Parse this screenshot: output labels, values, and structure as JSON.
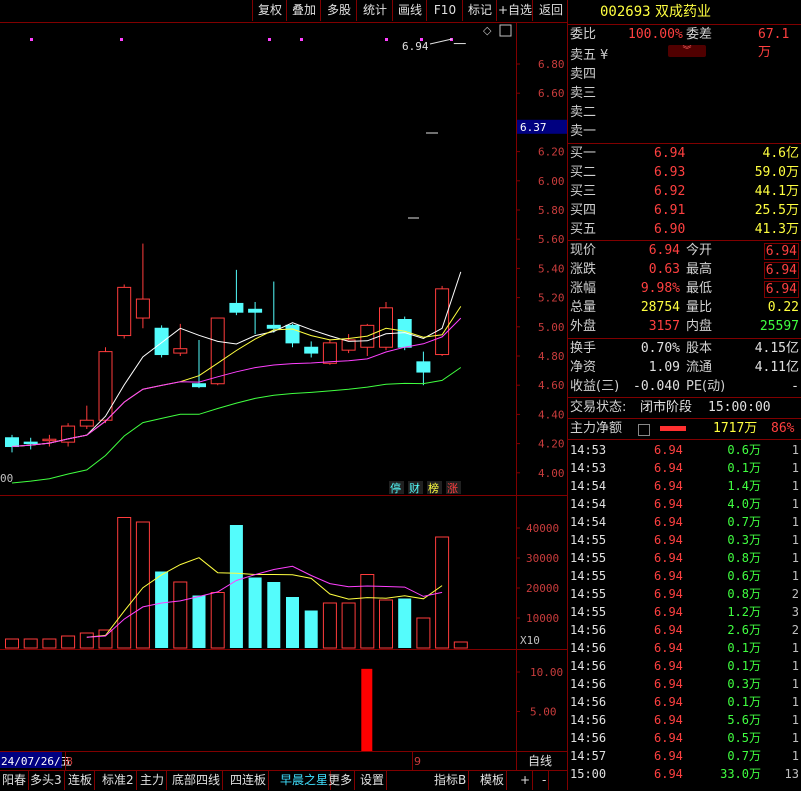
{
  "toolbar": {
    "buttons": [
      "复权",
      "叠加",
      "多股",
      "统计",
      "画线",
      "F10",
      "标记",
      "+自选",
      "返回"
    ]
  },
  "stock": {
    "code": "002693",
    "name": "双成药业"
  },
  "order_ratio": {
    "label": "委比",
    "value": "100.00%",
    "diff_label": "委差",
    "diff_value": "67.1万"
  },
  "asks": [
    {
      "label": "卖五",
      "price": "",
      "vol": ""
    },
    {
      "label": "卖四",
      "price": "",
      "vol": ""
    },
    {
      "label": "卖三",
      "price": "",
      "vol": ""
    },
    {
      "label": "卖二",
      "price": "",
      "vol": ""
    },
    {
      "label": "卖一",
      "price": "",
      "vol": ""
    }
  ],
  "bids": [
    {
      "label": "买一",
      "price": "6.94",
      "vol": "4.6亿"
    },
    {
      "label": "买二",
      "price": "6.93",
      "vol": "59.0万"
    },
    {
      "label": "买三",
      "price": "6.92",
      "vol": "44.1万"
    },
    {
      "label": "买四",
      "price": "6.91",
      "vol": "25.5万"
    },
    {
      "label": "买五",
      "price": "6.90",
      "vol": "41.3万"
    }
  ],
  "quote": [
    {
      "l1": "现价",
      "v1": "6.94",
      "l2": "今开",
      "v2": "6.94"
    },
    {
      "l1": "涨跌",
      "v1": "0.63",
      "l2": "最高",
      "v2": "6.94"
    },
    {
      "l1": "涨幅",
      "v1": "9.98%",
      "l2": "最低",
      "v2": "6.94"
    },
    {
      "l1": "总量",
      "v1": "28754",
      "l2": "量比",
      "v2": "0.22"
    },
    {
      "l1": "外盘",
      "v1": "3157",
      "l2": "内盘",
      "v2": "25597"
    }
  ],
  "stats": [
    {
      "l1": "换手",
      "v1": "0.70%",
      "l2": "股本",
      "v2": "4.15亿"
    },
    {
      "l1": "净资",
      "v1": "1.09",
      "l2": "流通",
      "v2": "4.11亿"
    },
    {
      "l1": "收益(三)",
      "v1": "-0.040",
      "l2": "PE(动)",
      "v2": "-"
    }
  ],
  "trade_status": {
    "label": "交易状态:",
    "phase": "闭市阶段",
    "time": "15:00:00"
  },
  "main_net": {
    "label": "主力净额",
    "value": "1717万",
    "pct": "86%"
  },
  "ticks": [
    {
      "t": "14:53",
      "p": "6.94",
      "v": "0.6万",
      "n": "1"
    },
    {
      "t": "14:53",
      "p": "6.94",
      "v": "0.1万",
      "n": "1"
    },
    {
      "t": "14:54",
      "p": "6.94",
      "v": "1.4万",
      "n": "1"
    },
    {
      "t": "14:54",
      "p": "6.94",
      "v": "4.0万",
      "n": "1"
    },
    {
      "t": "14:54",
      "p": "6.94",
      "v": "0.7万",
      "n": "1"
    },
    {
      "t": "14:55",
      "p": "6.94",
      "v": "0.3万",
      "n": "1"
    },
    {
      "t": "14:55",
      "p": "6.94",
      "v": "0.8万",
      "n": "1"
    },
    {
      "t": "14:55",
      "p": "6.94",
      "v": "0.6万",
      "n": "1"
    },
    {
      "t": "14:55",
      "p": "6.94",
      "v": "0.8万",
      "n": "2"
    },
    {
      "t": "14:55",
      "p": "6.94",
      "v": "1.2万",
      "n": "3"
    },
    {
      "t": "14:56",
      "p": "6.94",
      "v": "2.6万",
      "n": "2"
    },
    {
      "t": "14:56",
      "p": "6.94",
      "v": "0.1万",
      "n": "1"
    },
    {
      "t": "14:56",
      "p": "6.94",
      "v": "0.1万",
      "n": "1"
    },
    {
      "t": "14:56",
      "p": "6.94",
      "v": "0.3万",
      "n": "1"
    },
    {
      "t": "14:56",
      "p": "6.94",
      "v": "0.1万",
      "n": "1"
    },
    {
      "t": "14:56",
      "p": "6.94",
      "v": "5.6万",
      "n": "1"
    },
    {
      "t": "14:56",
      "p": "6.94",
      "v": "0.5万",
      "n": "1"
    },
    {
      "t": "14:57",
      "p": "6.94",
      "v": "0.7万",
      "n": "1"
    },
    {
      "t": "15:00",
      "p": "6.94",
      "v": "33.0万",
      "n": "13"
    }
  ],
  "chart_data": {
    "type": "candlestick",
    "price_axis": [
      "6.80",
      "6.60",
      "6.37",
      "6.20",
      "6.00",
      "5.80",
      "5.60",
      "5.40",
      "5.20",
      "5.00",
      "4.80",
      "4.60",
      "4.40",
      "4.20",
      "4.00"
    ],
    "current_price_label": "6.37",
    "high_marker": "6.94",
    "left_edge_label": "00",
    "badges": [
      "停",
      "财",
      "榜",
      "涨"
    ],
    "volume_axis": [
      "40000",
      "30000",
      "20000",
      "10000"
    ],
    "volume_multiplier": "X10",
    "indicator_axis": [
      "10.00",
      "5.00"
    ],
    "date_label": "24/07/26/五",
    "date_marker_left": "8",
    "date_marker_right": "9",
    "self_line_label": "自线",
    "candles": [
      {
        "o": 4.24,
        "c": 4.18,
        "h": 4.26,
        "l": 4.14,
        "up": false
      },
      {
        "o": 4.21,
        "c": 4.2,
        "h": 4.24,
        "l": 4.16,
        "up": false
      },
      {
        "o": 4.22,
        "c": 4.23,
        "h": 4.26,
        "l": 4.18,
        "up": true
      },
      {
        "o": 4.21,
        "c": 4.32,
        "h": 4.34,
        "l": 4.18,
        "up": true
      },
      {
        "o": 4.32,
        "c": 4.36,
        "h": 4.46,
        "l": 4.3,
        "up": true
      },
      {
        "o": 4.36,
        "c": 4.83,
        "h": 4.86,
        "l": 4.34,
        "up": true
      },
      {
        "o": 4.94,
        "c": 5.27,
        "h": 5.29,
        "l": 4.92,
        "up": true
      },
      {
        "o": 5.06,
        "c": 5.19,
        "h": 5.57,
        "l": 4.99,
        "up": true
      },
      {
        "o": 4.99,
        "c": 4.81,
        "h": 5.01,
        "l": 4.79,
        "up": false
      },
      {
        "o": 4.82,
        "c": 4.85,
        "h": 5.02,
        "l": 4.8,
        "up": true
      },
      {
        "o": 4.61,
        "c": 4.59,
        "h": 4.91,
        "l": 4.58,
        "up": false
      },
      {
        "o": 4.61,
        "c": 5.06,
        "h": 5.06,
        "l": 4.6,
        "up": true
      },
      {
        "o": 5.16,
        "c": 5.1,
        "h": 5.39,
        "l": 5.08,
        "up": false
      },
      {
        "o": 5.12,
        "c": 5.1,
        "h": 5.17,
        "l": 4.95,
        "up": false
      },
      {
        "o": 5.01,
        "c": 4.99,
        "h": 5.31,
        "l": 4.96,
        "up": false
      },
      {
        "o": 5.01,
        "c": 4.89,
        "h": 5.02,
        "l": 4.86,
        "up": false
      },
      {
        "o": 4.86,
        "c": 4.82,
        "h": 4.9,
        "l": 4.79,
        "up": false
      },
      {
        "o": 4.75,
        "c": 4.89,
        "h": 4.91,
        "l": 4.74,
        "up": true
      },
      {
        "o": 4.84,
        "c": 4.91,
        "h": 4.95,
        "l": 4.82,
        "up": true
      },
      {
        "o": 4.86,
        "c": 5.01,
        "h": 5.02,
        "l": 4.8,
        "up": true
      },
      {
        "o": 4.86,
        "c": 5.13,
        "h": 5.17,
        "l": 4.84,
        "up": true
      },
      {
        "o": 5.05,
        "c": 4.86,
        "h": 5.07,
        "l": 4.84,
        "up": false
      },
      {
        "o": 4.76,
        "c": 4.69,
        "h": 4.83,
        "l": 4.6,
        "up": false
      },
      {
        "o": 4.81,
        "c": 5.26,
        "h": 5.28,
        "l": 4.8,
        "up": true
      },
      {
        "o": 6.94,
        "c": 6.94,
        "h": 6.94,
        "l": 6.94,
        "up": true
      }
    ],
    "volumes": [
      {
        "v": 3000,
        "up": true
      },
      {
        "v": 3000,
        "up": true
      },
      {
        "v": 3000,
        "up": true
      },
      {
        "v": 4000,
        "up": true
      },
      {
        "v": 5000,
        "up": true
      },
      {
        "v": 6000,
        "up": true
      },
      {
        "v": 43500,
        "up": true
      },
      {
        "v": 42000,
        "up": true
      },
      {
        "v": 25500,
        "up": false
      },
      {
        "v": 22000,
        "up": true
      },
      {
        "v": 17500,
        "up": false
      },
      {
        "v": 18500,
        "up": true
      },
      {
        "v": 41000,
        "up": false
      },
      {
        "v": 23500,
        "up": false
      },
      {
        "v": 22000,
        "up": false
      },
      {
        "v": 17000,
        "up": false
      },
      {
        "v": 12500,
        "up": false
      },
      {
        "v": 15000,
        "up": true
      },
      {
        "v": 15000,
        "up": true
      },
      {
        "v": 24500,
        "up": true
      },
      {
        "v": 16000,
        "up": true
      },
      {
        "v": 16500,
        "up": false
      },
      {
        "v": 10000,
        "up": true
      },
      {
        "v": 37000,
        "up": true
      },
      {
        "v": 2000,
        "up": true
      }
    ],
    "indicator_bar": 10.4
  },
  "bottom_tabs": [
    "阳春",
    "多头3",
    "连板",
    "标准2",
    "主力",
    "底部四线",
    "四连板",
    "早晨之星",
    "更多",
    "设置",
    "指标B",
    "模板",
    "+",
    "-"
  ]
}
